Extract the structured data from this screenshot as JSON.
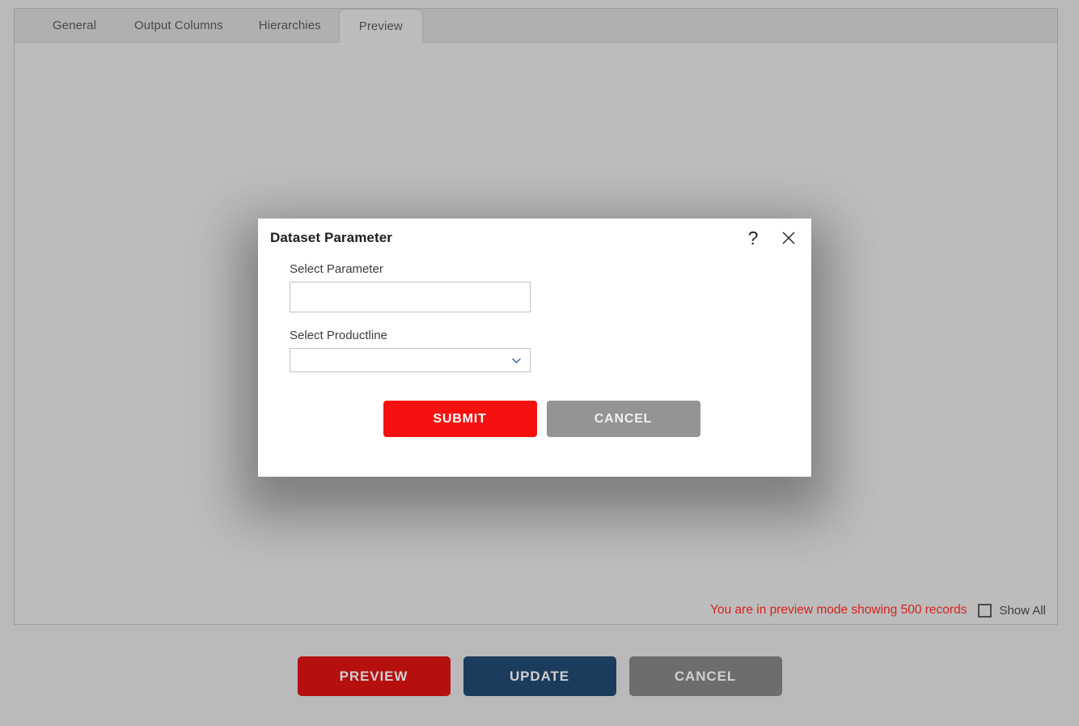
{
  "tabs": [
    {
      "label": "General",
      "active": false
    },
    {
      "label": "Output Columns",
      "active": false
    },
    {
      "label": "Hierarchies",
      "active": false
    },
    {
      "label": "Preview",
      "active": true
    }
  ],
  "preview_status": {
    "message": "You are in preview mode showing 500 records",
    "record_count": "500",
    "message_color": "#d8231f",
    "show_all_label": "Show All",
    "show_all_checked": false
  },
  "footer_actions": {
    "preview_label": "PREVIEW",
    "preview_color": "#b5100f",
    "update_label": "UPDATE",
    "update_color": "#1c3c5e",
    "cancel_label": "CANCEL",
    "cancel_color": "#6d6d6d"
  },
  "dialog": {
    "title": "Dataset Parameter",
    "help_icon": "help-question-icon",
    "help_glyph": "?",
    "close_icon": "close-x-icon",
    "fields": [
      {
        "label": "Select Parameter",
        "type": "text",
        "value": "",
        "placeholder": ""
      },
      {
        "label": "Select Productline",
        "type": "select",
        "value": "",
        "placeholder": "",
        "chevron_icon": "chevron-down-icon"
      }
    ],
    "submit_label": "SUBMIT",
    "submit_color": "#f5110f",
    "cancel_label": "CANCEL",
    "cancel_color": "#949494"
  }
}
